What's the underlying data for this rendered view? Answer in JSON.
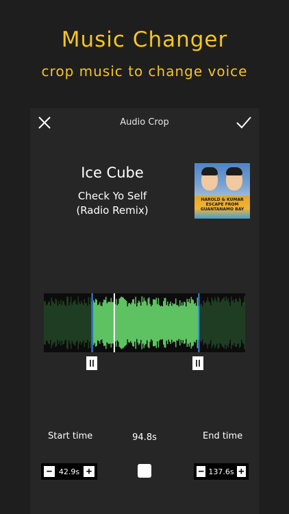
{
  "promo": {
    "title": "Music Changer",
    "subtitle": "crop music to change voice",
    "accent_color": "#f3c623"
  },
  "topbar": {
    "title": "Audio Crop",
    "close_icon": "close-icon",
    "confirm_icon": "checkmark-icon"
  },
  "track": {
    "artist": "Ice Cube",
    "song_line1": "Check Yo Self",
    "song_line2": "(Radio Remix)",
    "cover_text": "HAROLD & KUMAR ESCAPE FROM GUANTANAMO BAY"
  },
  "waveform": {
    "selection_start_fraction": 0.24,
    "selection_end_fraction": 0.77,
    "playhead_fraction": 0.35,
    "selected_color": "#5ec262",
    "unselected_color": "#1f3d22",
    "marker_color": "#2f8be0"
  },
  "controls": {
    "start_label": "Start time",
    "end_label": "End time",
    "duration": "94.8s",
    "start_value": "42.9s",
    "end_value": "137.6s",
    "minus": "−",
    "plus": "+"
  }
}
